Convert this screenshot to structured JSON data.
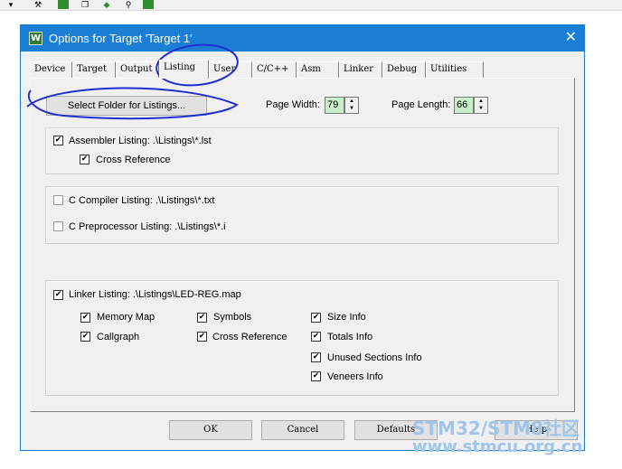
{
  "dialog": {
    "title": "Options for Target 'Target 1'",
    "close_glyph": "✕",
    "icon_letter": "W"
  },
  "tabs": [
    {
      "label": "Device",
      "active": false
    },
    {
      "label": "Target",
      "active": false
    },
    {
      "label": "Output",
      "active": false
    },
    {
      "label": "Listing",
      "active": true
    },
    {
      "label": "User",
      "active": false
    },
    {
      "label": "C/C++",
      "active": false
    },
    {
      "label": "Asm",
      "active": false
    },
    {
      "label": "Linker",
      "active": false
    },
    {
      "label": "Debug",
      "active": false
    },
    {
      "label": "Utilities",
      "active": false
    }
  ],
  "listing": {
    "select_folder_label": "Select Folder for Listings...",
    "page_width_label": "Page Width:",
    "page_width_value": "79",
    "page_length_label": "Page Length:",
    "page_length_value": "66",
    "assembler": {
      "label": "Assembler Listing:  .\\Listings\\*.lst",
      "checked": true
    },
    "cross_reference": {
      "label": "Cross Reference",
      "checked": true
    },
    "c_compiler": {
      "label": "C Compiler Listing:  .\\Listings\\*.txt",
      "checked": false
    },
    "c_preprocessor": {
      "label": "C Preprocessor Listing:  .\\Listings\\*.i",
      "checked": false
    },
    "linker": {
      "label": "Linker Listing:  .\\Listings\\LED-REG.map",
      "checked": true
    },
    "linker_options": {
      "memory_map": "Memory Map",
      "callgraph": "Callgraph",
      "symbols": "Symbols",
      "cross_reference": "Cross Reference",
      "size_info": "Size Info",
      "totals_info": "Totals Info",
      "unused_sections_info": "Unused Sections Info",
      "veneers_info": "Veneers Info"
    }
  },
  "footer": {
    "ok": "OK",
    "cancel": "Cancel",
    "defaults": "Defaults",
    "help": "Help"
  },
  "watermark": {
    "line1": "STM32/STM8社区",
    "line2": "www.stmcu.org.cn"
  },
  "colors": {
    "title_bar": "#1a7fd4",
    "spin_value_bg": "#c8f0c8",
    "annotation_ink": "#1f2fd0",
    "watermark": "#9fc6ea"
  },
  "check_glyph": "✔",
  "spin_up_glyph": "▲",
  "spin_down_glyph": "▼"
}
